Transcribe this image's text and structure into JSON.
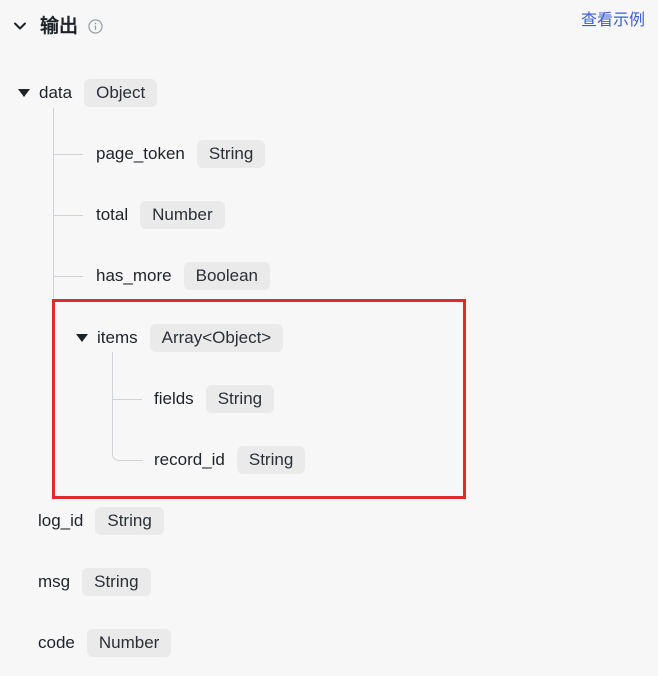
{
  "header": {
    "title": "输出",
    "example_link": "查看示例",
    "toggle_icon": "chevron-down-icon",
    "info_icon": "info-icon"
  },
  "colors": {
    "link": "#3c5bd8",
    "highlight_border": "#e02b2b",
    "badge_bg": "#eaeaea"
  },
  "fields": {
    "data": {
      "name": "data",
      "type": "Object",
      "expanded": true
    },
    "page_token": {
      "name": "page_token",
      "type": "String"
    },
    "total": {
      "name": "total",
      "type": "Number"
    },
    "has_more": {
      "name": "has_more",
      "type": "Boolean"
    },
    "items": {
      "name": "items",
      "type": "Array<Object>",
      "expanded": true
    },
    "fields": {
      "name": "fields",
      "type": "String"
    },
    "record_id": {
      "name": "record_id",
      "type": "String"
    },
    "log_id": {
      "name": "log_id",
      "type": "String"
    },
    "msg": {
      "name": "msg",
      "type": "String"
    },
    "code": {
      "name": "code",
      "type": "Number"
    }
  }
}
